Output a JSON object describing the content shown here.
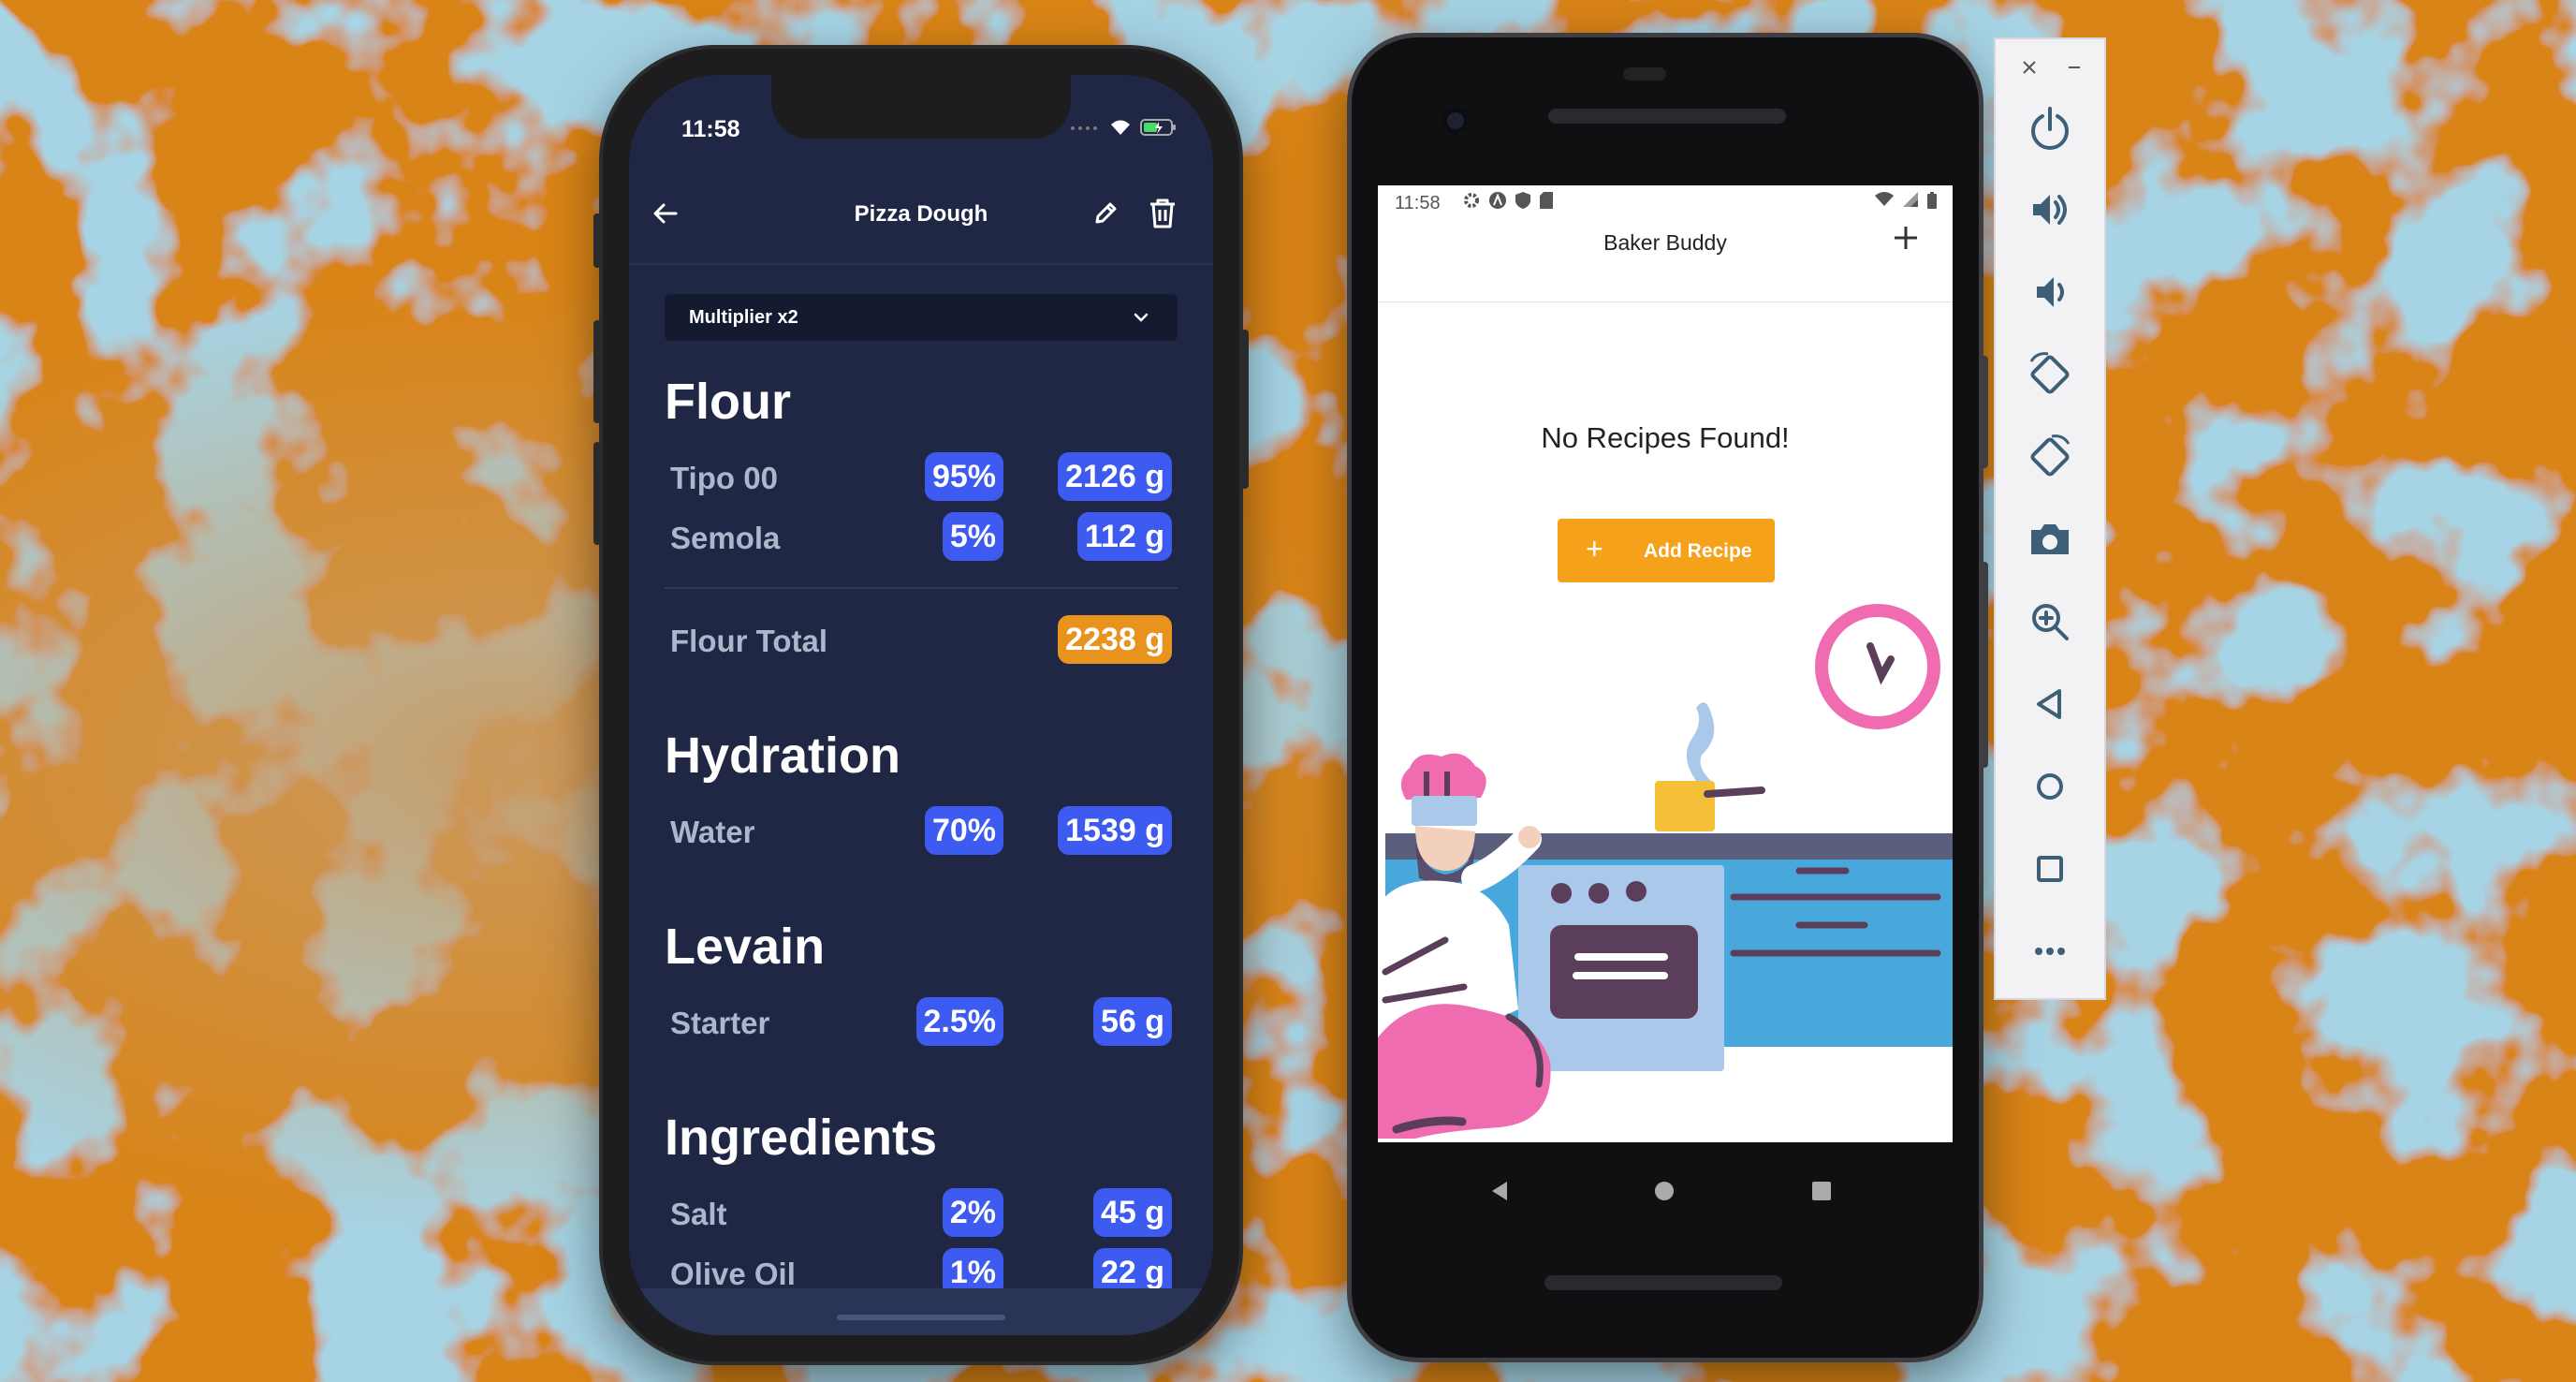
{
  "iphone": {
    "status_time": "11:58",
    "header_title": "Pizza Dough",
    "multiplier_label": "Multiplier x2",
    "sections": {
      "flour": {
        "title": "Flour",
        "rows": [
          {
            "name": "Tipo 00",
            "pct": "95%",
            "grams": "2126 g"
          },
          {
            "name": "Semola",
            "pct": "5%",
            "grams": "112 g"
          }
        ],
        "total_label": "Flour Total",
        "total_value": "2238 g"
      },
      "hydration": {
        "title": "Hydration",
        "rows": [
          {
            "name": "Water",
            "pct": "70%",
            "grams": "1539 g"
          }
        ]
      },
      "levain": {
        "title": "Levain",
        "rows": [
          {
            "name": "Starter",
            "pct": "2.5%",
            "grams": "56 g"
          }
        ]
      },
      "ingredients": {
        "title": "Ingredients",
        "rows": [
          {
            "name": "Salt",
            "pct": "2%",
            "grams": "45 g"
          },
          {
            "name": "Olive Oil",
            "pct": "1%",
            "grams": "22 g"
          }
        ]
      }
    },
    "colors": {
      "background": "#1f2744",
      "pill": "#3d5af1",
      "total_pill": "#e8931e",
      "row_label": "#aeb6cb"
    }
  },
  "android": {
    "status_time": "11:58",
    "app_title": "Baker Buddy",
    "empty_message": "No Recipes Found!",
    "add_button_icon": "+",
    "add_button_label": "Add Recipe",
    "colors": {
      "accent": "#f5a21a"
    }
  },
  "emulator_toolbar": {
    "window_close_glyph": "✕",
    "window_min_glyph": "–",
    "buttons": [
      "power-icon",
      "volume-up-icon",
      "volume-down-icon",
      "rotate-left-icon",
      "rotate-right-icon",
      "camera-icon",
      "zoom-icon",
      "back-icon",
      "home-icon",
      "overview-icon",
      "more-icon"
    ]
  }
}
